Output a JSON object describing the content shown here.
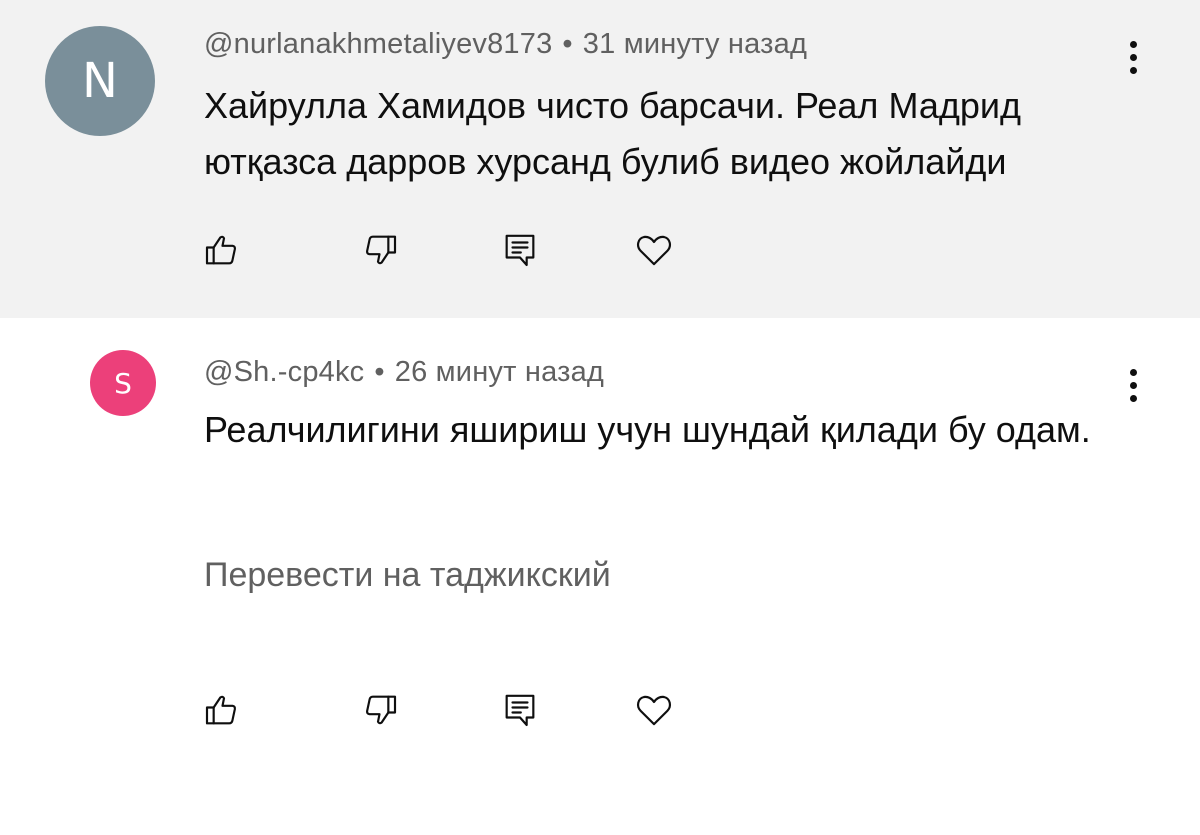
{
  "comments": [
    {
      "avatar_letter": "N",
      "avatar_color": "#7a8f9a",
      "author": "@nurlanakhmetaliyev8173",
      "time": "31 минуту назад",
      "text": "Хайрулла Хамидов чисто барсачи. Реал Мадрид ютқазса дарров хурсанд булиб видео жойлайди",
      "background": "#f2f2f2"
    },
    {
      "avatar_letter": "S",
      "avatar_color": "#ec407a",
      "author": "@Sh.-cp4kc",
      "time": "26 минут назад",
      "text": "Реалчилигини яшириш учун шундай қилади бу одам.",
      "translate_label": "Перевести на таджикский",
      "background": "#ffffff"
    }
  ],
  "separator": "•",
  "icons": {
    "like": "thumbs-up-icon",
    "dislike": "thumbs-down-icon",
    "reply": "reply-icon",
    "heart": "heart-icon",
    "menu": "more-vertical-icon"
  }
}
